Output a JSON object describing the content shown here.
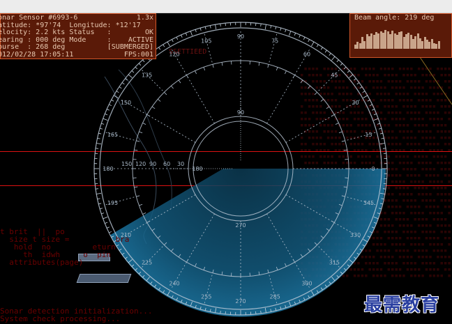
{
  "status": {
    "title": "onar Sensor #6993-6",
    "zoom": "1.3x",
    "rows": [
      {
        "label": "atitude: *97'74  Longitude: *12'17",
        "value": ""
      },
      {
        "label": "elocity: 2.2 kts Status   :",
        "value": "OK"
      },
      {
        "label": "earing : 000 deg Mode     :",
        "value": "ACTIVE"
      },
      {
        "label": "ourse  : 268 deg",
        "value": "[SUBMERGED]"
      },
      {
        "label": "012/02/28 17:05:11",
        "value": "FPS:001"
      }
    ]
  },
  "beam": {
    "title": "Beam angle: 219 deg",
    "levels": [
      0.2,
      0.35,
      0.3,
      0.6,
      0.4,
      0.75,
      0.65,
      0.8,
      0.7,
      0.85,
      0.78,
      0.9,
      0.82,
      0.95,
      0.88,
      0.76,
      0.92,
      0.8,
      0.7,
      0.85,
      0.9,
      0.6,
      0.75,
      0.82,
      0.7,
      0.5,
      0.65,
      0.78,
      0.55,
      0.4,
      0.6,
      0.45,
      0.35,
      0.5,
      0.3,
      0.25,
      0.4
    ]
  },
  "dial": {
    "outer_labels": [
      "90",
      "75",
      "60",
      "45",
      "30",
      "15",
      "0",
      "345",
      "330",
      "315",
      "300",
      "285",
      "270",
      "255",
      "240",
      "225",
      "210",
      "195",
      "180",
      "165",
      "150",
      "135",
      "120",
      "105"
    ],
    "inner_labels": [
      "30",
      "60",
      "90",
      "120",
      "150"
    ],
    "bearing_small": [
      "90",
      "270",
      "180"
    ]
  },
  "console": {
    "mid_lines": [
      "t brit  ||  po               ",
      "  size t size =          bra",
      "   hold  no         eturn",
      "     th  idwh     o  pin",
      "  attributes(page)"
    ],
    "bottom_lines": [
      "Sonar detection initialization...",
      "System check processing..."
    ]
  },
  "bg_text": "  SSETTIEED",
  "logo": "最需教育",
  "colors": {
    "accent": "#5aa9d6",
    "panel_bg": "#5a1a08",
    "panel_border": "#d2572a",
    "alert_line": "#d11111"
  }
}
